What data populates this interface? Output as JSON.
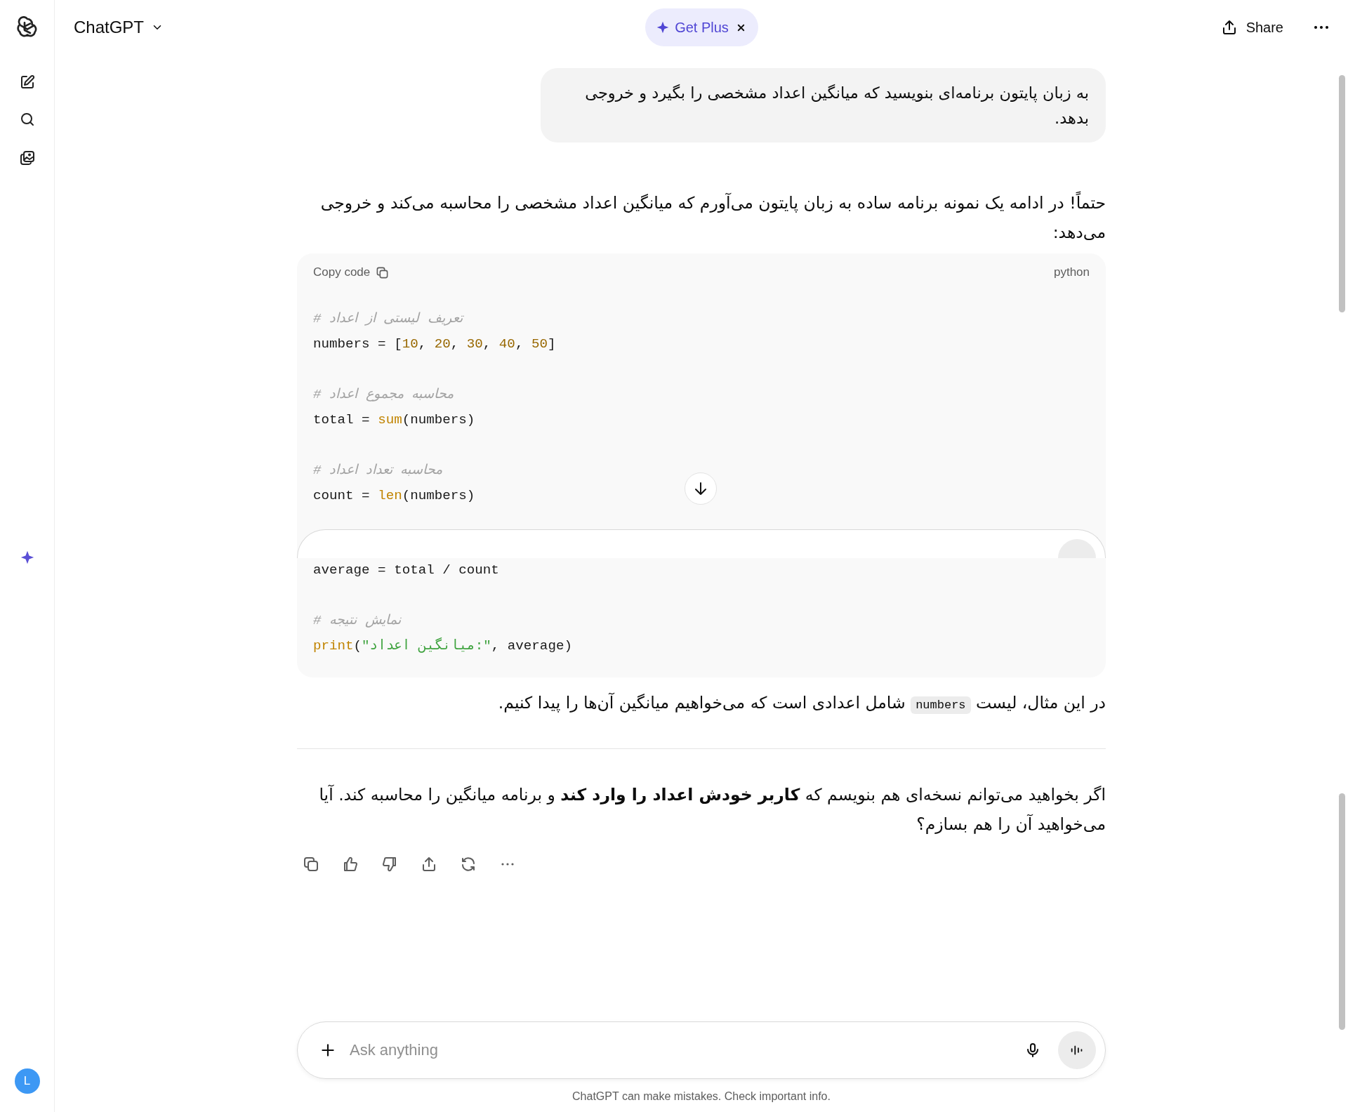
{
  "sidebar": {
    "avatar": {
      "initial": "L"
    }
  },
  "header": {
    "title": "ChatGPT",
    "promo": {
      "label": "Get Plus"
    },
    "share": {
      "label": "Share"
    }
  },
  "conversation": {
    "user_message": {
      "text": "به زبان پایتون برنامه‌ای بنویسید که میانگین اعداد مشخصی را بگیرد و خروجی بدهد."
    },
    "assistant_blocks": [
      {
        "kind": "paragraph",
        "segments": [
          {
            "kind": "text",
            "text": "حتماً! در ادامه یک نمونه برنامه ساده به زبان پایتون می‌آورم که میانگین اعداد مشخصی را محاسبه می‌کند و خروجی می‌دهد:"
          }
        ]
      },
      {
        "kind": "code",
        "copy_label": "Copy code",
        "language": "python",
        "lines": [
          {
            "kind": "code",
            "text": "# تعریف لیستی از اعداد"
          },
          {
            "kind": "code",
            "text": "numbers = [10, 20, 30, 40, 50]"
          },
          {
            "kind": "blank"
          },
          {
            "kind": "code",
            "text": "# محاسبه مجموع اعداد"
          },
          {
            "kind": "code",
            "text": "total = sum(numbers)"
          },
          {
            "kind": "blank"
          },
          {
            "kind": "code",
            "text": "# محاسبه تعداد اعداد"
          },
          {
            "kind": "code",
            "text": "count = len(numbers)"
          },
          {
            "kind": "input_fragment"
          },
          {
            "kind": "code",
            "text": "average = total / count"
          },
          {
            "kind": "blank"
          },
          {
            "kind": "code",
            "text": "# نمایش نتیجه"
          },
          {
            "kind": "code",
            "text": "print(\"میانگین اعداد:\", average)"
          }
        ]
      },
      {
        "kind": "paragraph",
        "segments": [
          {
            "kind": "text",
            "text": "در این مثال، لیست "
          },
          {
            "kind": "code",
            "text": "numbers"
          },
          {
            "kind": "text",
            "text": " شامل اعدادی است که می‌خواهیم میانگین آن‌ها را پیدا کنیم."
          }
        ]
      },
      {
        "kind": "rule"
      },
      {
        "kind": "paragraph",
        "segments": [
          {
            "kind": "text",
            "text": "اگر بخواهید می‌توانم نسخه‌ای هم بنویسم که **کاربر خودش اعداد را وارد کند** و برنامه میانگین را محاسبه کند. آیا می‌خواهید آن را هم بسازم؟"
          }
        ]
      }
    ]
  },
  "composer": {
    "placeholder": "Ask anything"
  },
  "footer": {
    "text": "ChatGPT can make mistakes. Check important info."
  }
}
